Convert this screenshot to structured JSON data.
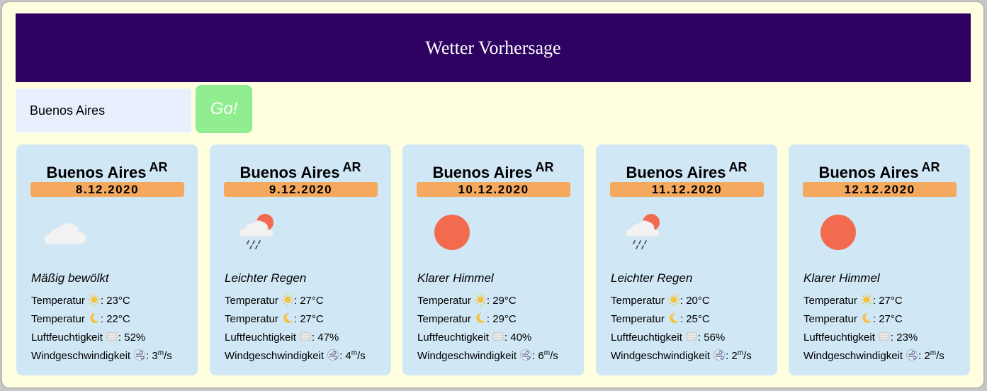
{
  "header": {
    "title": "Wetter Vorhersage"
  },
  "search": {
    "value": "Buenos Aires",
    "button_label": "Go!"
  },
  "labels": {
    "temp": "Temperatur",
    "humidity": "Luftfeuchtigkeit",
    "wind": "Windgeschwindigkeit",
    "wind_unit_sup": "m",
    "wind_unit_rest": "/s"
  },
  "cards": [
    {
      "city": "Buenos Aires",
      "country": "AR",
      "date": "8.12.2020",
      "icon": "cloud-icon",
      "description": "Mäßig bewölkt",
      "temp_day": ": 23°C",
      "temp_night": ": 22°C",
      "humidity": ": 52%",
      "wind": ": 3"
    },
    {
      "city": "Buenos Aires",
      "country": "AR",
      "date": "9.12.2020",
      "icon": "light-rain-icon",
      "description": "Leichter Regen",
      "temp_day": ": 27°C",
      "temp_night": ": 27°C",
      "humidity": ": 47%",
      "wind": ": 4"
    },
    {
      "city": "Buenos Aires",
      "country": "AR",
      "date": "10.12.2020",
      "icon": "clear-sky-icon",
      "description": "Klarer Himmel",
      "temp_day": ": 29°C",
      "temp_night": ": 29°C",
      "humidity": ": 40%",
      "wind": ": 6"
    },
    {
      "city": "Buenos Aires",
      "country": "AR",
      "date": "11.12.2020",
      "icon": "light-rain-icon",
      "description": "Leichter Regen",
      "temp_day": ": 20°C",
      "temp_night": ": 25°C",
      "humidity": ": 56%",
      "wind": ": 2"
    },
    {
      "city": "Buenos Aires",
      "country": "AR",
      "date": "12.12.2020",
      "icon": "clear-sky-icon",
      "description": "Klarer Himmel",
      "temp_day": ": 27°C",
      "temp_night": ": 27°C",
      "humidity": ": 23%",
      "wind": ": 2"
    }
  ],
  "colors": {
    "header_bg": "#2d0261",
    "page_bg": "#ffffe0",
    "card_bg": "#d0e7f5",
    "date_bg": "#f4a95e",
    "go_button_bg": "#90ee90",
    "sun": "#f26b4f"
  }
}
